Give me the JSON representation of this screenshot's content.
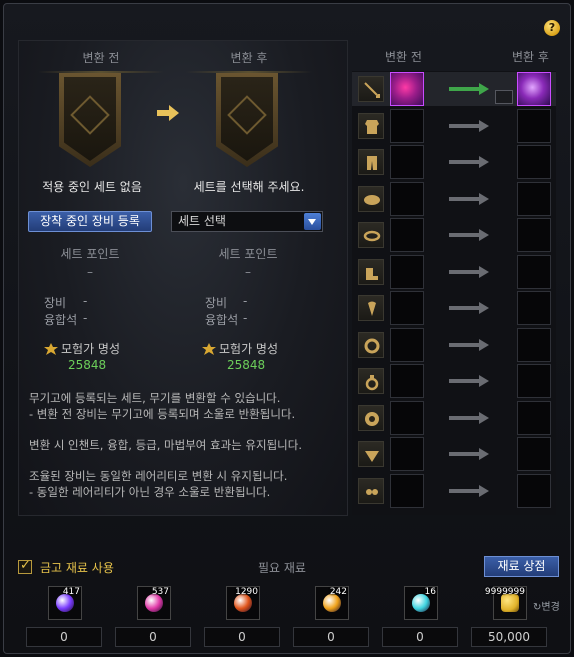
{
  "help_label": "?",
  "left": {
    "before_header": "변환 전",
    "after_header": "변환 후",
    "before_caption": "적용 중인 세트 없음",
    "after_caption": "세트를 선택해 주세요.",
    "register_button": "장착 중인 장비 등록",
    "set_select": {
      "value": "세트 선택"
    },
    "set_point_label": "세트 포인트",
    "set_point_value": "–",
    "equip_label": "장비",
    "fusion_label": "융합석",
    "stat_dash": "-",
    "fame_label": "모험가 명성",
    "fame_before": "25848",
    "fame_after": "25848",
    "notes": [
      "무기고에 등록되는 세트, 무기를 변환할 수 있습니다.",
      "- 변환 전 장비는 무기고에 등록되며 소울로 반환됩니다.",
      "변환 시 인챈트, 융합, 등급, 마법부여 효과는 유지됩니다.",
      "조율된 장비는 동일한 레어리티로 변환 시 유지됩니다.",
      "- 동일한 레어리티가 아닌 경우 소울로 반환됩니다."
    ]
  },
  "right": {
    "before_header": "변환 전",
    "after_header": "변환 후",
    "slots": [
      "weapon-icon",
      "top-armor-icon",
      "bottom-armor-icon",
      "shoulder-icon",
      "belt-icon",
      "shoes-icon",
      "amulet-icon",
      "bracelet-icon",
      "ring-icon",
      "support-icon",
      "magic-stone-icon",
      "earring-icon"
    ]
  },
  "bottom": {
    "use_vault_label": "금고 재료 사용",
    "required_title": "필요 재료",
    "shop_button": "재료 상점",
    "materials": [
      {
        "count": "417",
        "qty": "0",
        "color": "#7a3cff"
      },
      {
        "count": "537",
        "qty": "0",
        "color": "#e13aa8"
      },
      {
        "count": "1290",
        "qty": "0",
        "color": "#e0541a"
      },
      {
        "count": "242",
        "qty": "0",
        "color": "#f0a21a"
      },
      {
        "count": "16",
        "qty": "0",
        "color": "#3fd4e0"
      },
      {
        "count": "9999999",
        "qty": "50,000",
        "color": "#e0b22a"
      }
    ],
    "change_label": "변경"
  }
}
